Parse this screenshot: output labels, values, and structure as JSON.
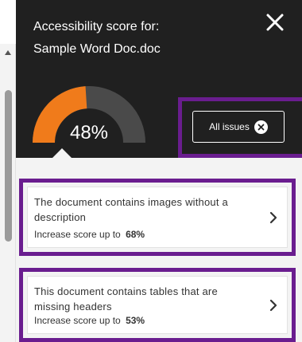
{
  "header": {
    "title": "Accessibility score for:",
    "document_name": "Sample Word Doc.doc"
  },
  "score": {
    "percent": 48,
    "label": "48%",
    "fill_color": "#f07b1b",
    "track_color": "#4a4a4a"
  },
  "all_issues": {
    "label": "All issues"
  },
  "highlight_color": "#6a1d8f",
  "issues": [
    {
      "description": "The document contains images without a description",
      "score_prefix": "Increase score up to",
      "score_value": "68%"
    },
    {
      "description": "This document contains tables that are missing headers",
      "score_prefix": "Increase score up to",
      "score_value": "53%"
    }
  ],
  "icons": {
    "close": "close-icon",
    "clear": "clear-circle-icon",
    "chevron": "chevron-right-icon",
    "scroll_up": "scroll-up-arrow-icon"
  }
}
